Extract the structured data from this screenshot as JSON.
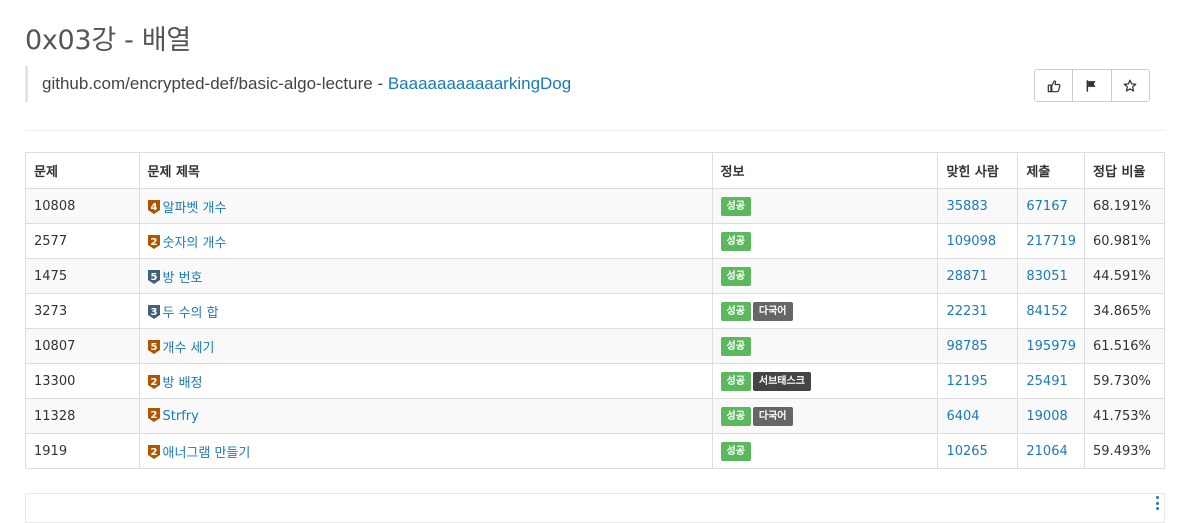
{
  "page": {
    "title": "0x03강 - 배열",
    "source_text": "github.com/encrypted-def/basic-algo-lecture - ",
    "author_link": "BaaaaaaaaaaarkingDog"
  },
  "actions": [
    {
      "icon": "thumbs-up-icon"
    },
    {
      "icon": "flag-icon"
    },
    {
      "icon": "star-icon"
    }
  ],
  "table": {
    "headers": [
      "문제",
      "문제 제목",
      "정보",
      "맞힌 사람",
      "제출",
      "정답 비율"
    ],
    "rows": [
      {
        "id": "10808",
        "tier": "4",
        "tier_color": "#ad5600",
        "title": "알파벳 개수",
        "labels": [
          "성공"
        ],
        "solved": "35883",
        "submissions": "67167",
        "ratio": "68.191%"
      },
      {
        "id": "2577",
        "tier": "2",
        "tier_color": "#ad5600",
        "title": "숫자의 개수",
        "labels": [
          "성공"
        ],
        "solved": "109098",
        "submissions": "217719",
        "ratio": "60.981%"
      },
      {
        "id": "1475",
        "tier": "5",
        "tier_color": "#435f7a",
        "title": "방 번호",
        "labels": [
          "성공"
        ],
        "solved": "28871",
        "submissions": "83051",
        "ratio": "44.591%"
      },
      {
        "id": "3273",
        "tier": "3",
        "tier_color": "#435f7a",
        "title": "두 수의 합",
        "labels": [
          "성공",
          "다국어"
        ],
        "solved": "22231",
        "submissions": "84152",
        "ratio": "34.865%"
      },
      {
        "id": "10807",
        "tier": "5",
        "tier_color": "#ad5600",
        "title": "개수 세기",
        "labels": [
          "성공"
        ],
        "solved": "98785",
        "submissions": "195979",
        "ratio": "61.516%"
      },
      {
        "id": "13300",
        "tier": "2",
        "tier_color": "#ad5600",
        "title": "방 배정",
        "labels": [
          "성공",
          "서브태스크"
        ],
        "solved": "12195",
        "submissions": "25491",
        "ratio": "59.730%"
      },
      {
        "id": "11328",
        "tier": "2",
        "tier_color": "#ad5600",
        "title": "Strfry",
        "labels": [
          "성공",
          "다국어"
        ],
        "solved": "6404",
        "submissions": "19008",
        "ratio": "41.753%"
      },
      {
        "id": "1919",
        "tier": "2",
        "tier_color": "#ad5600",
        "title": "애너그램 만들기",
        "labels": [
          "성공"
        ],
        "solved": "10265",
        "submissions": "21064",
        "ratio": "59.493%"
      }
    ]
  },
  "label_colors": {
    "성공": "#5cb85c",
    "다국어": "#666666",
    "서브태스크": "#444444"
  },
  "link_color": "#1a7bb9"
}
